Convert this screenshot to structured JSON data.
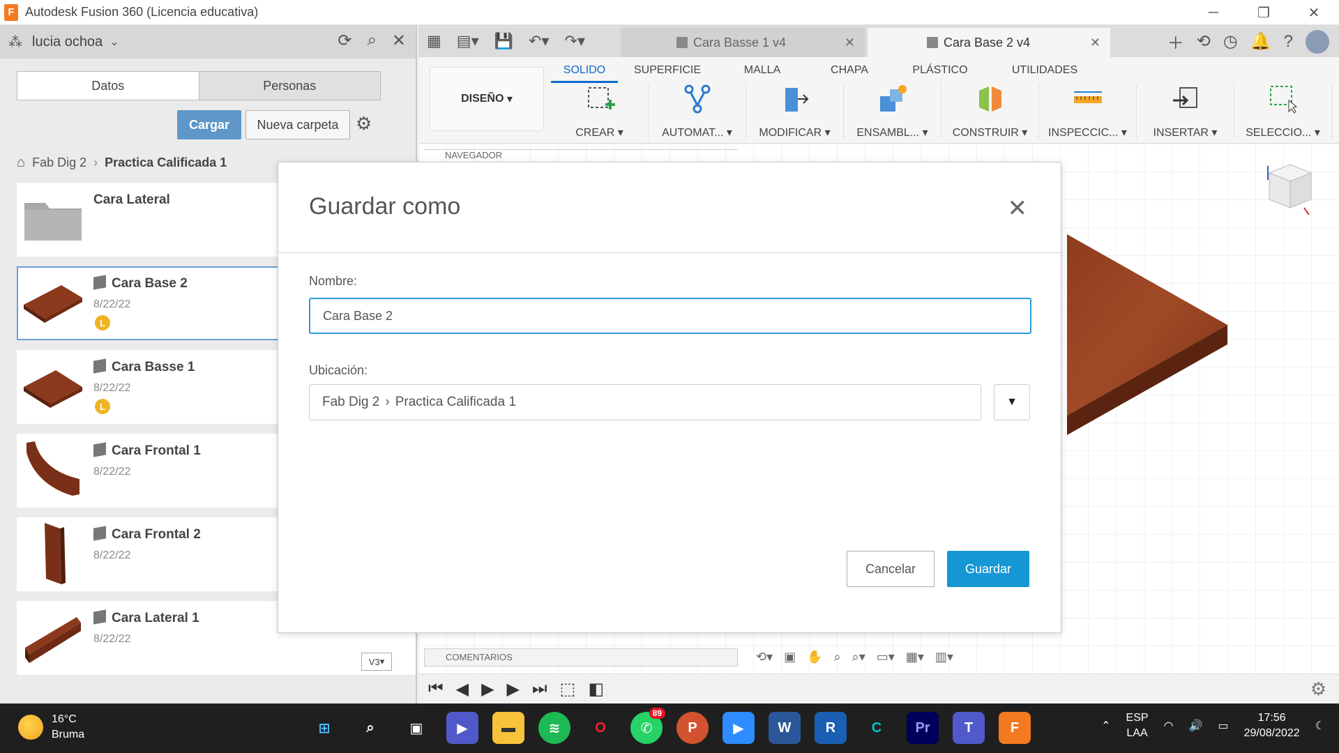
{
  "window": {
    "title": "Autodesk Fusion 360 (Licencia educativa)",
    "logo_letter": "F"
  },
  "left_panel": {
    "user": "lucia ochoa",
    "tabs": [
      "Datos",
      "Personas"
    ],
    "upload_label": "Cargar",
    "new_folder_label": "Nueva carpeta",
    "breadcrumb": [
      "Fab Dig 2",
      "Practica Calificada 1"
    ],
    "files": [
      {
        "name": "Cara Lateral",
        "date": "",
        "badge": "",
        "type": "folder"
      },
      {
        "name": "Cara Base 2",
        "date": "8/22/22",
        "badge": "L",
        "type": "design"
      },
      {
        "name": "Cara Basse 1",
        "date": "8/22/22",
        "badge": "L",
        "type": "design"
      },
      {
        "name": "Cara Frontal 1",
        "date": "8/22/22",
        "badge": "",
        "type": "design"
      },
      {
        "name": "Cara Frontal 2",
        "date": "8/22/22",
        "badge": "",
        "type": "design"
      },
      {
        "name": "Cara Lateral 1",
        "date": "8/22/22",
        "badge": "",
        "type": "design",
        "version": "V3"
      }
    ]
  },
  "main": {
    "doc_tabs": [
      {
        "label": "Cara Basse 1 v4",
        "active": false
      },
      {
        "label": "Cara Base 2 v4",
        "active": true
      }
    ],
    "workspace_label": "DISEÑO",
    "ribbon_tabs": [
      "SOLIDO",
      "SUPERFICIE",
      "MALLA",
      "CHAPA",
      "PLÁSTICO",
      "UTILIDADES"
    ],
    "active_ribbon_tab": "SOLIDO",
    "ribbon_groups": [
      "CREAR",
      "AUTOMAT...",
      "MODIFICAR",
      "ENSAMBL...",
      "CONSTRUIR",
      "INSPECCIC...",
      "INSERTAR",
      "SELECCIO..."
    ],
    "navigator_label": "NAVEGADOR",
    "comments_label": "COMENTARIOS"
  },
  "dialog": {
    "title": "Guardar como",
    "name_label": "Nombre:",
    "name_value": "Cara Base 2",
    "location_label": "Ubicación:",
    "location_path": [
      "Fab Dig 2",
      "Practica Calificada 1"
    ],
    "cancel_label": "Cancelar",
    "save_label": "Guardar"
  },
  "taskbar": {
    "temperature": "16°C",
    "weather": "Bruma",
    "whatsapp_badge": "89",
    "lang_top": "ESP",
    "lang_bottom": "LAA",
    "time": "17:56",
    "date": "29/08/2022"
  },
  "colors": {
    "accent": "#1597d5",
    "upload_button": "#5f97c9",
    "fusion_orange": "#f47a20",
    "wood": "#8b3a1e"
  }
}
